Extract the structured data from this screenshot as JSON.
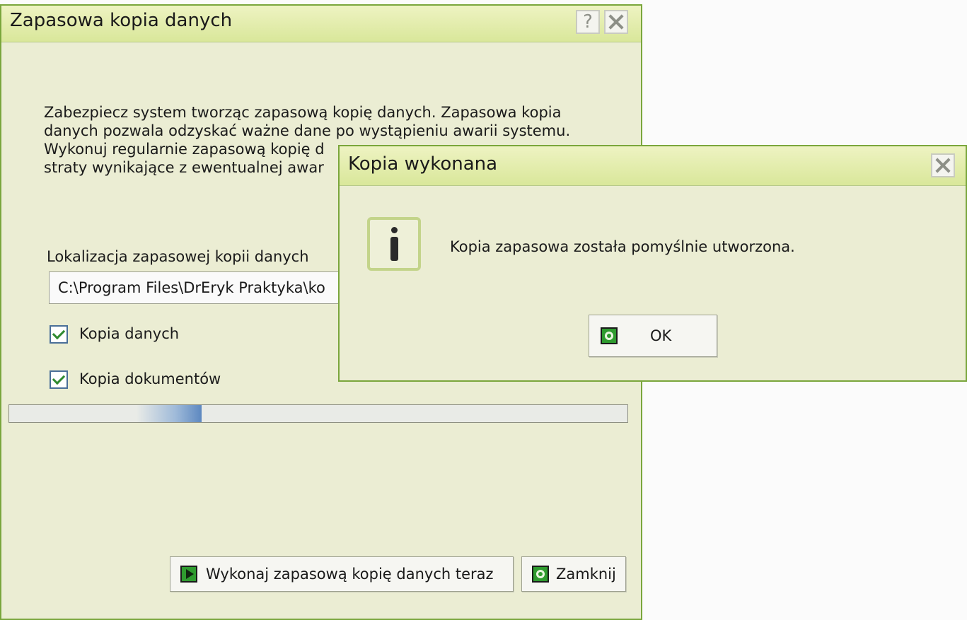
{
  "main_dialog": {
    "title": "Zapasowa kopia danych",
    "help_symbol": "?",
    "description": "Zabezpiecz system tworząc zapasową kopię danych. Zapasowa kopia\ndanych pozwala odzyskać ważne dane po wystąpieniu awarii systemu.\nWykonuj regularnie zapasową kopię d\nstraty wynikające z ewentualnej awar",
    "location_label": "Lokalizacja zapasowej kopii danych",
    "location_value": "C:\\Program Files\\DrEryk Praktyka\\ko",
    "checkbox_data": {
      "label": "Kopia danych",
      "checked": true
    },
    "checkbox_docs": {
      "label": "Kopia dokumentów",
      "checked": true
    },
    "progress_indicator": "marquee",
    "run_button": "Wykonaj zapasową kopię danych teraz",
    "close_button": "Zamknij"
  },
  "message_dialog": {
    "title": "Kopia wykonana",
    "message": "Kopia zapasowa została pomyślnie utworzona.",
    "ok_button": "OK",
    "icon": "info-icon"
  },
  "colors": {
    "window_border": "#7aa63c",
    "titlebar": "#d9e79a",
    "window_background": "#ebedd3",
    "button_icon": "#2f9b2f"
  }
}
